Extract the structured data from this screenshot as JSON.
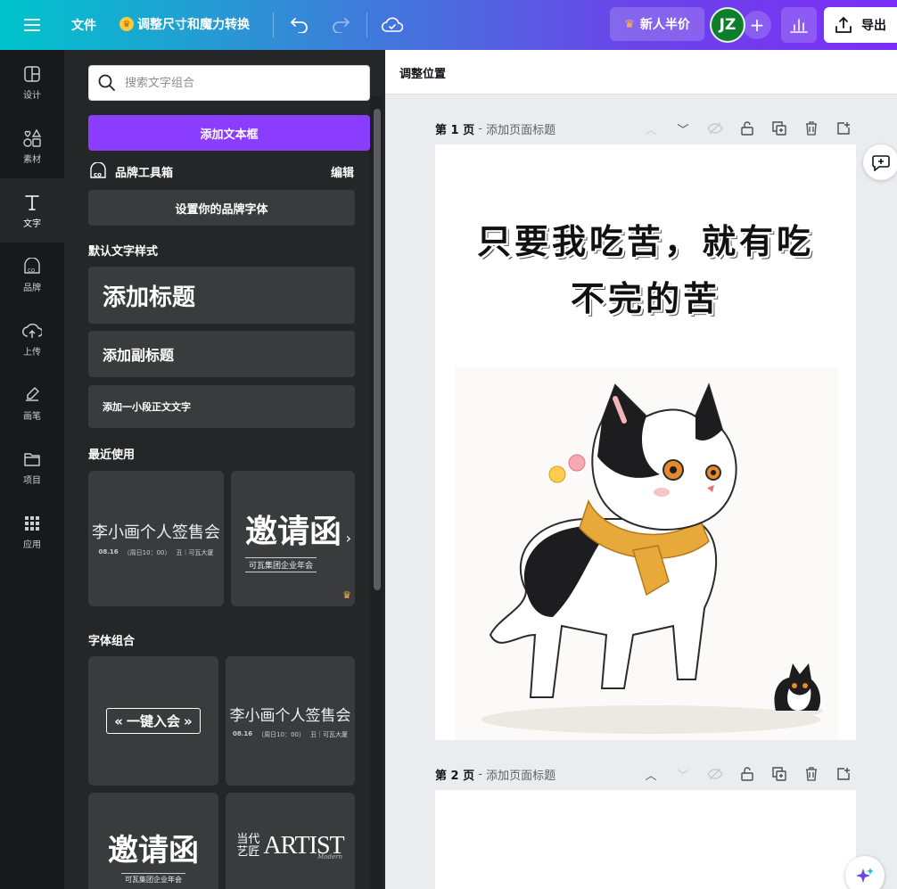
{
  "topbar": {
    "file_label": "文件",
    "resize_label": "调整尺寸和魔力转换",
    "half_price_label": "新人半价",
    "avatar_initials": "JZ",
    "export_label": "导出",
    "colors": {
      "gradient_start": "#00c4cc",
      "gradient_end": "#7b2ff7",
      "avatar": "#0d7f2a",
      "crown": "#ffc83d"
    },
    "icons": [
      "hamburger-menu-icon",
      "crown-icon",
      "undo-icon",
      "redo-icon",
      "cloud-sync-icon",
      "plus-icon",
      "bar-chart-icon",
      "upload-icon"
    ]
  },
  "rail": {
    "items": [
      {
        "label": "设计",
        "icon": "layout-icon"
      },
      {
        "label": "素材",
        "icon": "shapes-icon"
      },
      {
        "label": "文字",
        "icon": "text-icon",
        "active": true
      },
      {
        "label": "品牌",
        "icon": "brand-icon"
      },
      {
        "label": "上传",
        "icon": "cloud-upload-icon"
      },
      {
        "label": "画笔",
        "icon": "brush-icon"
      },
      {
        "label": "项目",
        "icon": "folder-icon"
      },
      {
        "label": "应用",
        "icon": "grid-apps-icon"
      }
    ]
  },
  "panel": {
    "search_placeholder": "搜索文字组合",
    "add_textbox_label": "添加文本框",
    "brand_toolkit_label": "品牌工具箱",
    "brand_edit_label": "编辑",
    "brand_font_label": "设置你的品牌字体",
    "default_styles_title": "默认文字样式",
    "heading_label": "添加标题",
    "subheading_label": "添加副标题",
    "body_label": "添加一小段正文文字",
    "recent_title": "最近使用",
    "combos_title": "字体组合",
    "accent_color": "#8b3dff",
    "templates": {
      "signing_title": "李小画个人签售会",
      "signing_date": "08.16",
      "signing_day": "（周日10：00）",
      "signing_venue": "丑｜可瓦大厦",
      "invite_title": "邀请函",
      "invite_sub": "可瓦集团企业年会",
      "one_click": "一键入会",
      "artist_cn_1": "当代",
      "artist_cn_2": "艺匠",
      "artist_en": "ARTIST",
      "artist_script": "Modern"
    }
  },
  "canvas": {
    "toolbar_label": "调整位置",
    "pages": [
      {
        "label": "第 1 页",
        "title_placeholder": "添加页面标题",
        "headline_line1": "只要我吃苦，就有吃",
        "headline_line2": "不完的苦"
      },
      {
        "label": "第 2 页",
        "title_placeholder": "添加页面标题"
      }
    ],
    "separator": " - "
  }
}
